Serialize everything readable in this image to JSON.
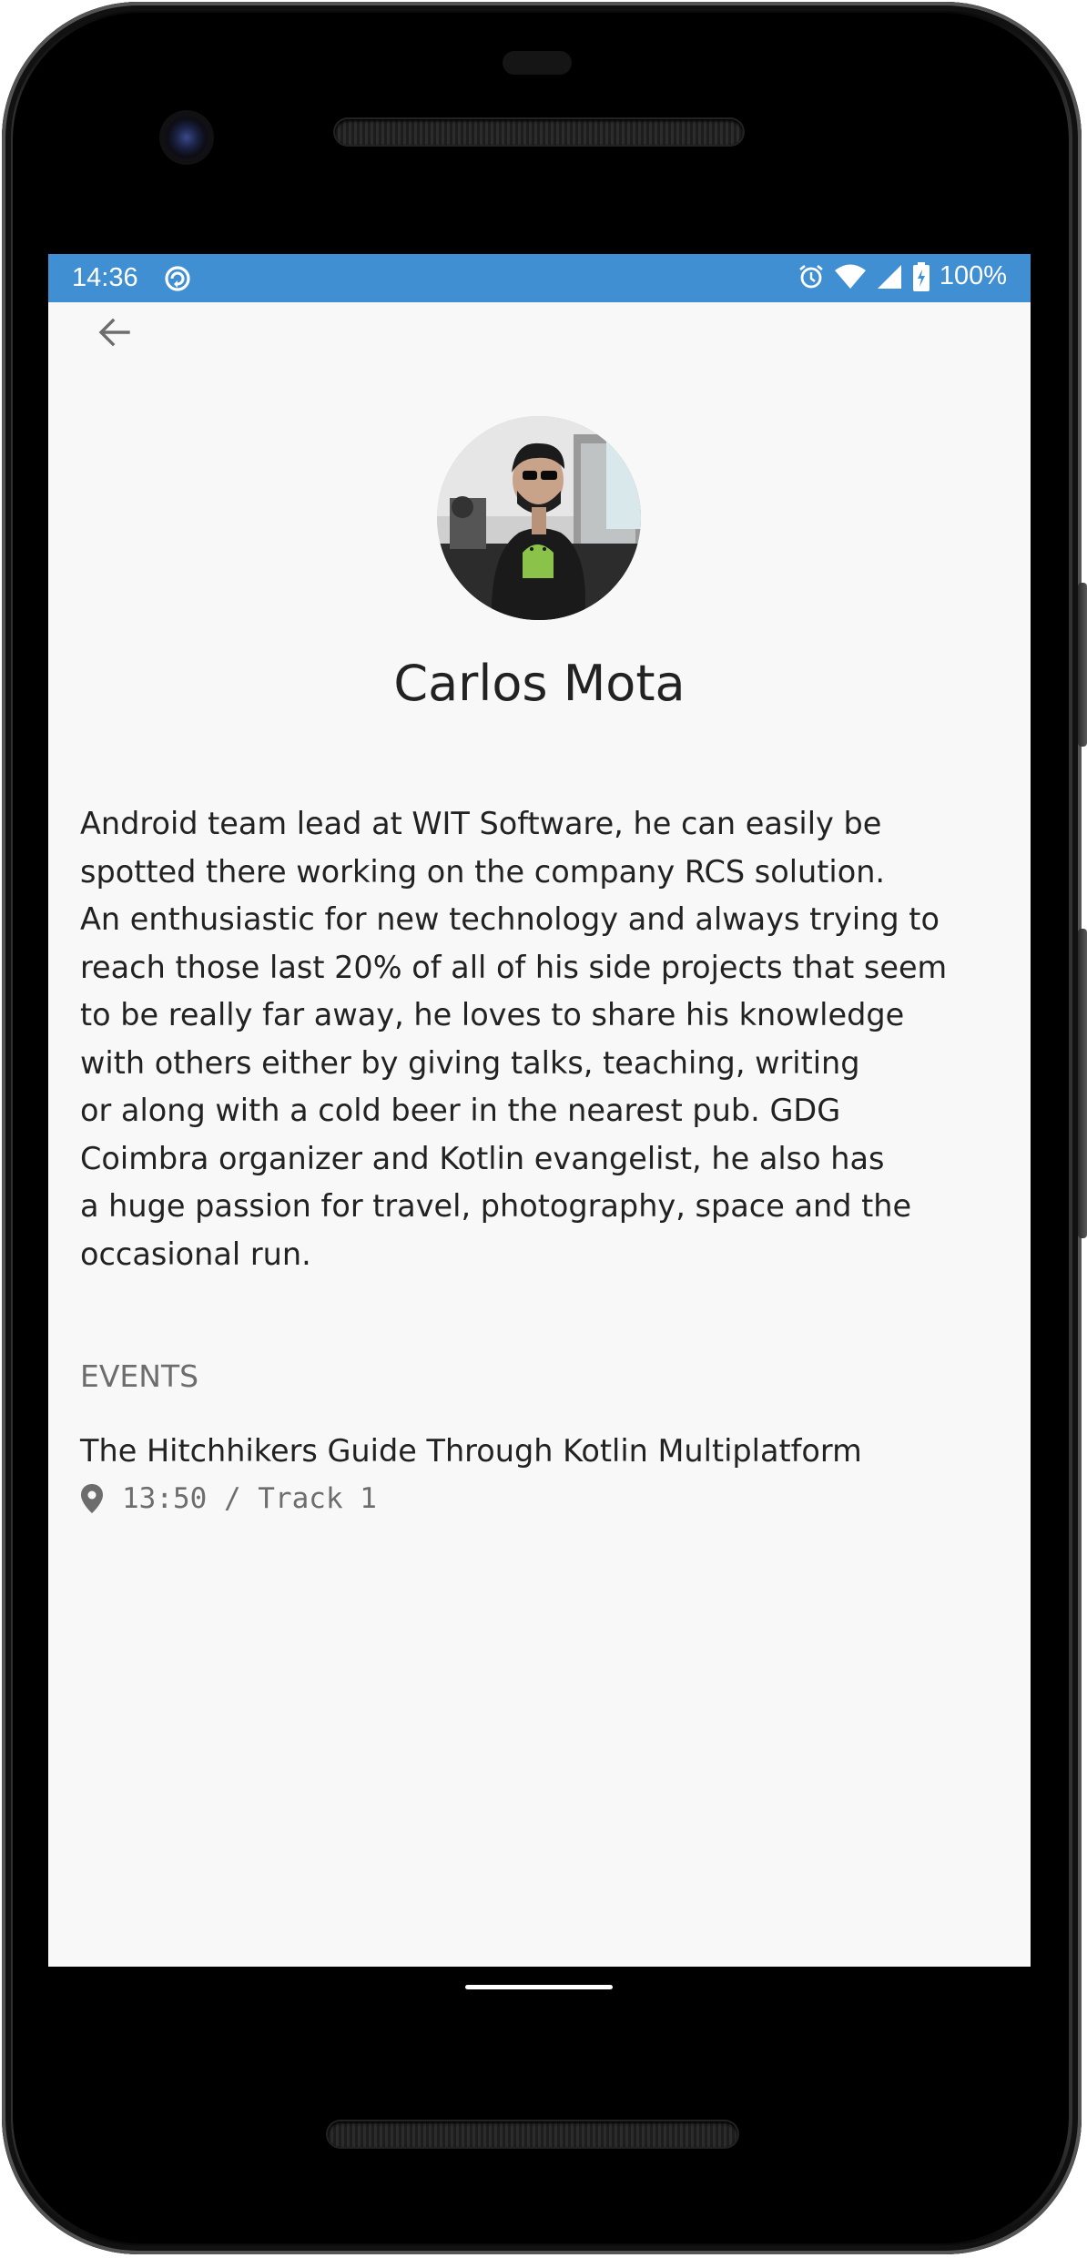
{
  "status_bar": {
    "time": "14:36",
    "battery": "100%",
    "icons": [
      "sync-icon",
      "alarm-icon",
      "wifi-icon",
      "signal-icon",
      "battery-icon"
    ],
    "background_color": "#3f8fd2"
  },
  "toolbar": {
    "back_icon": "arrow-back-icon"
  },
  "speaker": {
    "name": "Carlos Mota",
    "bio_lines": [
      "Android team lead at WIT Software, he can easily be",
      "spotted there working on the company RCS solution.",
      "An enthusiastic for new technology and always trying to",
      "reach those last 20% of all of his side projects that seem",
      "to be really far away, he loves to share his knowledge",
      "with others either by giving talks, teaching, writing",
      "or along with a cold beer in the nearest pub. GDG",
      "Coimbra organizer and Kotlin evangelist, he also has",
      "a huge passion for travel, photography, space and the",
      "occasional run."
    ]
  },
  "events": {
    "section_title": "EVENTS",
    "items": [
      {
        "title": "The Hitchhikers Guide Through Kotlin Multiplatform",
        "meta": "13:50 / Track 1",
        "icon": "location-pin-icon"
      }
    ]
  }
}
